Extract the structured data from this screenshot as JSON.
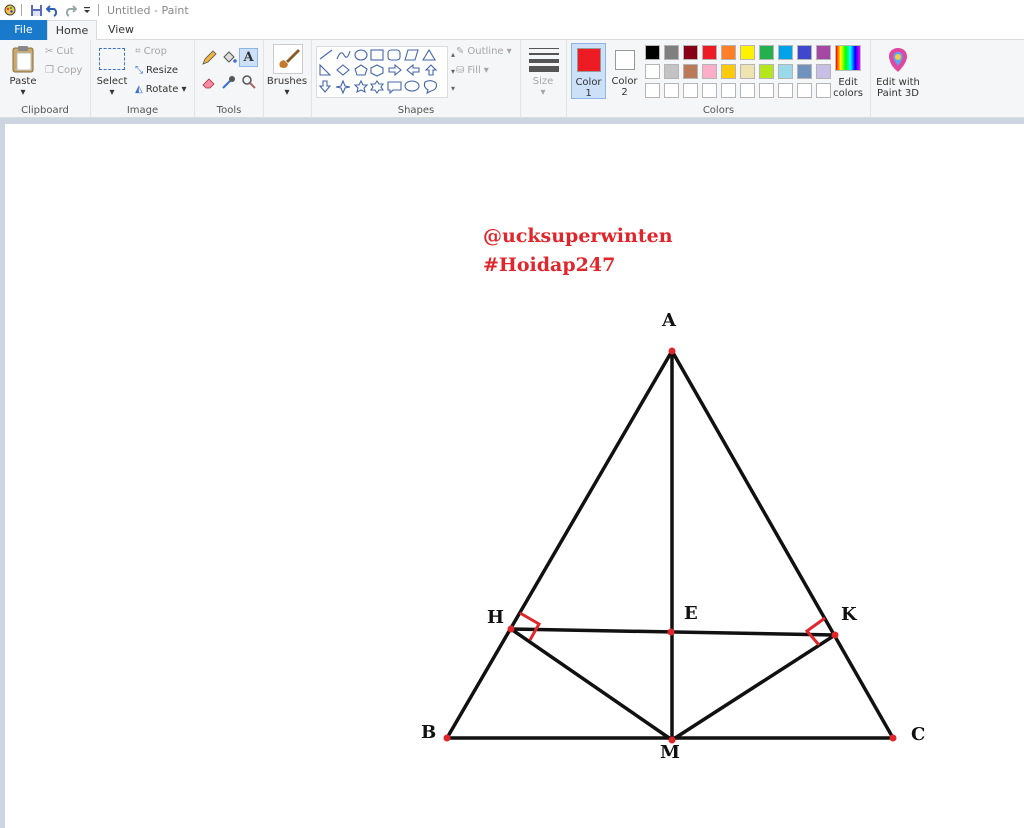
{
  "window": {
    "title": "Untitled - Paint"
  },
  "tabs": {
    "file": "File",
    "home": "Home",
    "view": "View"
  },
  "clipboard": {
    "paste": "Paste",
    "cut": "Cut",
    "copy": "Copy",
    "label": "Clipboard"
  },
  "image": {
    "select": "Select",
    "crop": "Crop",
    "resize": "Resize",
    "rotate": "Rotate",
    "label": "Image"
  },
  "tools": {
    "label": "Tools"
  },
  "brushes": {
    "label": "Brushes"
  },
  "shapes": {
    "outline": "Outline",
    "fill": "Fill",
    "label": "Shapes"
  },
  "size": {
    "label": "Size"
  },
  "colors": {
    "color1_label": "Color",
    "color1_num": "1",
    "color2_label": "Color",
    "color2_num": "2",
    "color1_value": "#ed1c24",
    "color2_value": "#ffffff",
    "edit_colors_1": "Edit",
    "edit_colors_2": "colors",
    "label": "Colors",
    "palette_row1": [
      "#000000",
      "#7f7f7f",
      "#880015",
      "#ed1c24",
      "#ff7f27",
      "#fff200",
      "#22b14c",
      "#00a2e8",
      "#3f48cc",
      "#a349a4"
    ],
    "palette_row2": [
      "#ffffff",
      "#c3c3c3",
      "#b97a57",
      "#ffaec9",
      "#ffc90e",
      "#efe4b0",
      "#b5e61d",
      "#99d9ea",
      "#7092be",
      "#c8bfe7"
    ],
    "palette_row3": [
      "#ffffff",
      "#ffffff",
      "#ffffff",
      "#ffffff",
      "#ffffff",
      "#ffffff",
      "#ffffff",
      "#ffffff",
      "#ffffff",
      "#ffffff"
    ]
  },
  "paint3d": {
    "line1": "Edit with",
    "line2": "Paint 3D"
  },
  "drawing": {
    "watermark_user": "@ucksuperwinten",
    "watermark_tag": "#Hoidap247",
    "labels": {
      "A": "A",
      "B": "B",
      "C": "C",
      "H": "H",
      "K": "K",
      "E": "E",
      "M": "M"
    }
  }
}
